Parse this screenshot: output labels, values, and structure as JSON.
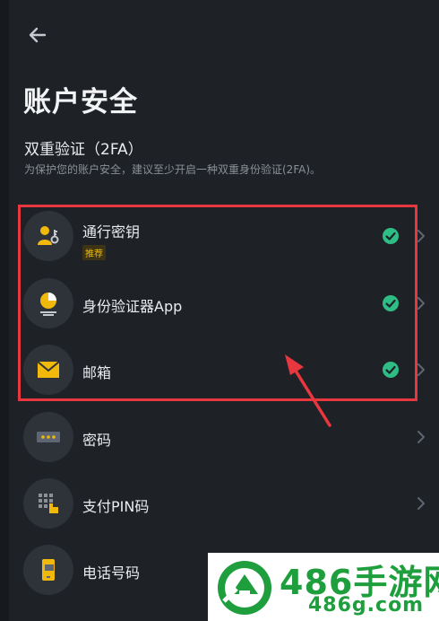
{
  "header": {
    "title": "账户安全"
  },
  "twofa": {
    "title": "双重验证（2FA）",
    "subtitle": "为保护您的账户安全，建议至少开启一种双重身份验证(2FA)。"
  },
  "items": [
    {
      "label": "通行密钥",
      "tag": "推荐",
      "icon": "passkey-icon",
      "enabled": true
    },
    {
      "label": "身份验证器App",
      "icon": "authenticator-icon",
      "enabled": true
    },
    {
      "label": "邮箱",
      "icon": "email-icon",
      "enabled": true
    },
    {
      "label": "密码",
      "icon": "password-icon",
      "enabled": false
    },
    {
      "label": "支付PIN码",
      "icon": "pin-icon",
      "enabled": false
    },
    {
      "label": "电话号码",
      "icon": "phone-icon",
      "enabled": false
    }
  ],
  "watermark": {
    "brand": "486手游网",
    "url": "486g.com"
  },
  "colors": {
    "background": "#1e2126",
    "icon_bg": "#2e3239",
    "accent_yellow": "#f0b90b",
    "check_green": "#2ebd85",
    "highlight_red": "#e8373e",
    "watermark_green": "#1e9e3c"
  }
}
